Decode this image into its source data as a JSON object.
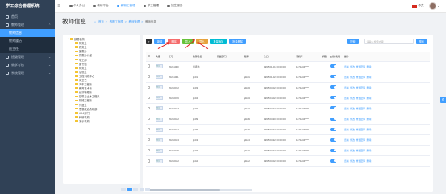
{
  "app": {
    "title": "学工综合管理系统"
  },
  "sidebar": {
    "items": [
      {
        "label": "首页",
        "type": "top"
      },
      {
        "label": "教师管理",
        "type": "top",
        "expanded": true
      },
      {
        "label": "教师信息",
        "type": "sub",
        "active": true
      },
      {
        "label": "教师履历",
        "type": "sub"
      },
      {
        "label": "班主任",
        "type": "sub"
      },
      {
        "label": "班级管理",
        "type": "top"
      },
      {
        "label": "教学考核",
        "type": "top"
      },
      {
        "label": "系统管理",
        "type": "top"
      }
    ]
  },
  "topnav": {
    "items": [
      {
        "label": "个人办公"
      },
      {
        "label": "教研平台"
      },
      {
        "label": "教职工管理",
        "active": true
      },
      {
        "label": "学工管理"
      },
      {
        "label": "招生服务"
      }
    ],
    "lang": "中文"
  },
  "page": {
    "title": "教师信息",
    "breadcrumb": [
      "首页",
      "教职工管理",
      "教师管理",
      "教师信息"
    ]
  },
  "tree": {
    "items": [
      {
        "label": "部属机构",
        "depth": 0,
        "expanded": true
      },
      {
        "label": "财务处",
        "depth": 1
      },
      {
        "label": "教务处",
        "depth": 1
      },
      {
        "label": "团委办",
        "depth": 1
      },
      {
        "label": "党委办公室",
        "depth": 1
      },
      {
        "label": "学工部",
        "depth": 1
      },
      {
        "label": "图书馆",
        "depth": 1
      },
      {
        "label": "财务处",
        "depth": 1
      },
      {
        "label": "后勤处",
        "depth": 1
      },
      {
        "label": "工程训练中心",
        "depth": 1
      },
      {
        "label": "体卫艺",
        "depth": 1
      },
      {
        "label": "汽车工程系",
        "depth": 1
      },
      {
        "label": "教育艺术系",
        "depth": 1
      },
      {
        "label": "经济管理系",
        "depth": 1
      },
      {
        "label": "建筑与土木工程系",
        "depth": 1
      },
      {
        "label": "机械工程系",
        "depth": 1
      },
      {
        "label": "外语处",
        "depth": 1
      },
      {
        "label": "思想政治教研部",
        "depth": 1
      },
      {
        "label": "AAA部门",
        "depth": 1
      },
      {
        "label": "科研机构",
        "depth": 1
      },
      {
        "label": "演示机构",
        "depth": 1
      }
    ]
  },
  "toolbar": {
    "buttons": [
      "新增",
      "删除",
      "导入",
      "导出",
      "批量添加",
      "批量删除"
    ],
    "search_placeholder": "请输入搜索内容",
    "search_button": "搜索",
    "reset_button": "搜索"
  },
  "table": {
    "columns": [
      "",
      "头像",
      "工号",
      "教师姓名",
      "所属部门",
      "职称",
      "生日",
      "手机号",
      "邮箱",
      "启用/禁用",
      "操作"
    ],
    "rows": [
      [
        "",
        "预览",
        "20211000",
        "刘鑫达",
        "",
        "",
        "1995-01-01 00:00:00",
        "1871234****",
        "",
        "",
        "",
        ""
      ],
      [
        "",
        "预览",
        "20211001",
        "jin01",
        "",
        "jdk01",
        "1995-01-02 00:00:00",
        "1871234****",
        "",
        "",
        "",
        ""
      ],
      [
        "",
        "预览",
        "20210032",
        "jin03",
        "",
        "jdk03",
        "1995-03-02 00:00:00",
        "1871234****",
        "",
        "",
        "",
        ""
      ],
      [
        "",
        "预览",
        "20210036",
        "jin04",
        "",
        "jdk04",
        "1995-04-02 00:00:00",
        "1871234****",
        "",
        "",
        "",
        ""
      ],
      [
        "",
        "预览",
        "20210047",
        "jin40",
        "",
        "jdk40",
        "1995-03-22 00:00:00",
        "1871234****",
        "",
        "",
        "",
        ""
      ],
      [
        "",
        "预览",
        "20210042",
        "jin09",
        "",
        "jdk09",
        "1995-03-20 00:00:00",
        "1871234****",
        "",
        "",
        "",
        ""
      ],
      [
        "",
        "预览",
        "20210044",
        "jin45",
        "",
        "jdk45",
        "1995-03-22 00:00:00",
        "1871234****",
        "",
        "",
        "",
        ""
      ],
      [
        "",
        "预览",
        "20210043",
        "jin43",
        "",
        "jdk43",
        "1995-03-22 00:00:00",
        "1871234****",
        "",
        "",
        "",
        ""
      ],
      [
        "",
        "预览",
        "20210045",
        "jin46",
        "",
        "jdk46",
        "1995-03-22 00:00:00",
        "1871234****",
        "",
        "",
        "",
        ""
      ],
      [
        "",
        "预览",
        "20210042",
        "jin42",
        "",
        "jdk42",
        "1995-03-02 00:00:00",
        "1871234****",
        "",
        "",
        "",
        ""
      ]
    ],
    "actions": [
      "查看",
      "修改",
      "重置密码",
      "删除"
    ]
  },
  "colors": {
    "sidebar": "#304156",
    "accent": "#409eff",
    "danger": "#f56c6c",
    "success": "#67c23a",
    "warning": "#e6a23c",
    "arrow": "#e02020"
  }
}
